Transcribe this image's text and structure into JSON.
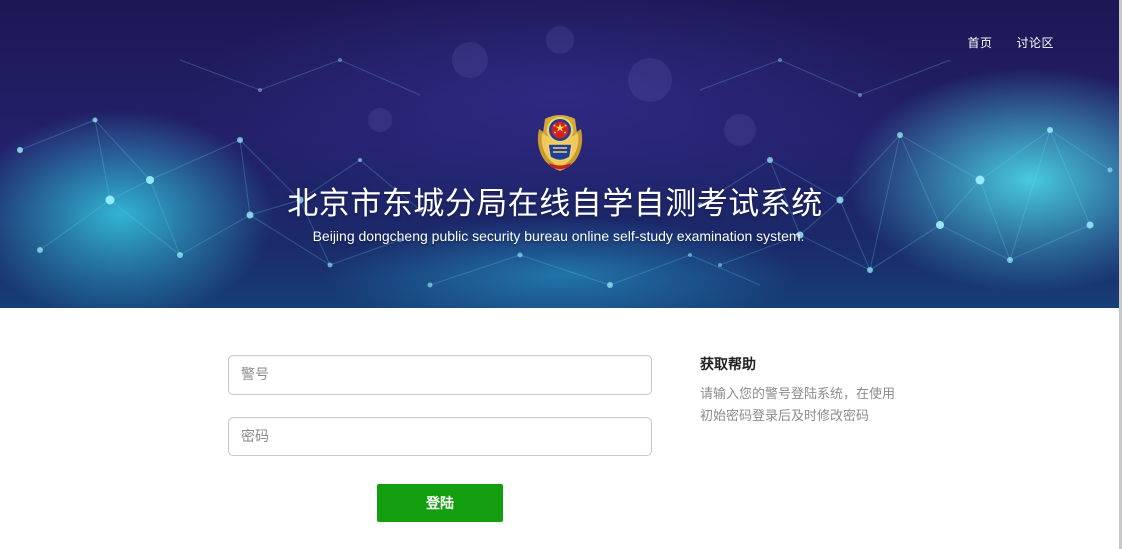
{
  "nav": {
    "items": [
      {
        "label": "首页"
      },
      {
        "label": "讨论区"
      }
    ]
  },
  "hero": {
    "title": "北京市东城分局在线自学自测考试系统",
    "subtitle": "Beijing dongcheng public security bureau online self-study examination system.",
    "emblem_icon": "police-emblem-icon"
  },
  "login": {
    "badge_placeholder": "警号",
    "badge_value": "",
    "password_placeholder": "密码",
    "password_value": "",
    "submit_label": "登陆"
  },
  "help": {
    "title": "获取帮助",
    "text": "请输入您的警号登陆系统，在使用初始密码登录后及时修改密码"
  },
  "colors": {
    "hero_dark": "#1c1854",
    "hero_glow": "#35cde4",
    "button_green": "#129e0e",
    "help_text": "#8c8c8c"
  }
}
